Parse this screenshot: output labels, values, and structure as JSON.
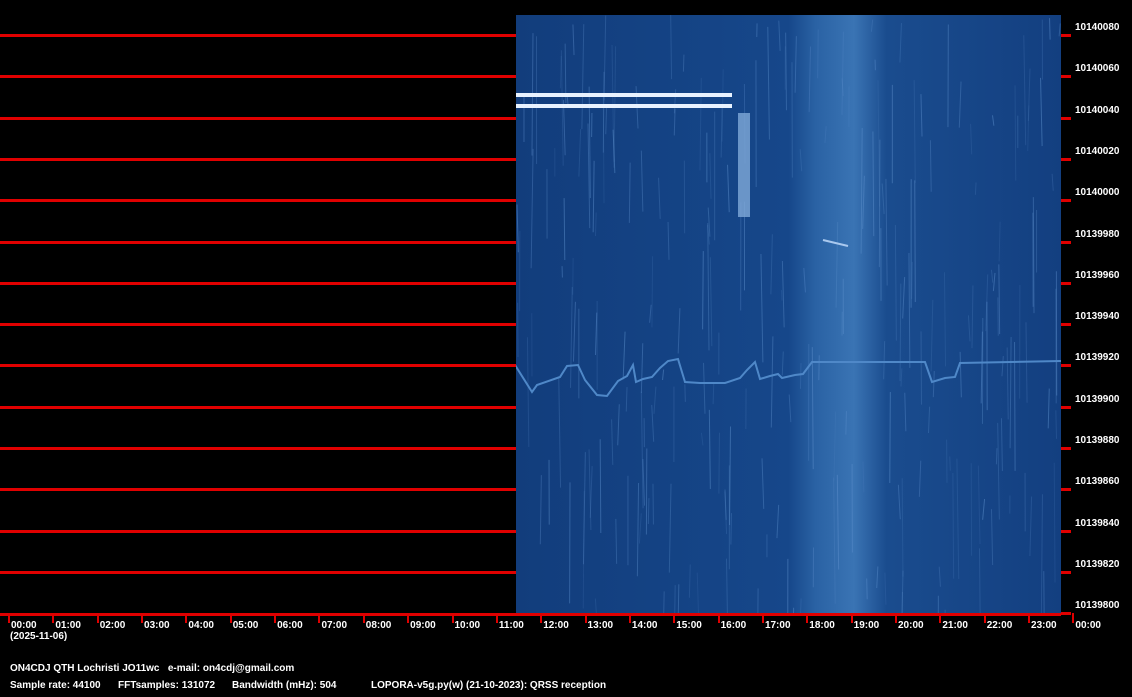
{
  "colors": {
    "grid": "#e00000",
    "spectrum_bg": "#123f80",
    "trace": "#4f88c8"
  },
  "freq_labels": [
    "10140080",
    "10140060",
    "10140040",
    "10140020",
    "10140000",
    "10139980",
    "10139960",
    "10139940",
    "10139920",
    "10139900",
    "10139880",
    "10139860",
    "10139840",
    "10139820",
    "10139800"
  ],
  "time_labels": [
    "00:00",
    "01:00",
    "02:00",
    "03:00",
    "04:00",
    "05:00",
    "06:00",
    "07:00",
    "08:00",
    "09:00",
    "10:00",
    "11:00",
    "12:00",
    "13:00",
    "14:00",
    "15:00",
    "16:00",
    "17:00",
    "18:00",
    "19:00",
    "20:00",
    "21:00",
    "22:00",
    "23:00",
    "00:00"
  ],
  "date": "(2025-11-06)",
  "station": "ON4CDJ QTH Lochristi JO11wc   e-mail: on4cdj@gmail.com",
  "params": {
    "sample_rate": "Sample rate: 44100",
    "fft": "FFTsamples: 131072",
    "bandwidth": "Bandwidth (mHz): 504",
    "software": "LOPORA-v5g.py(w) (21-10-2023): QRSS reception"
  }
}
